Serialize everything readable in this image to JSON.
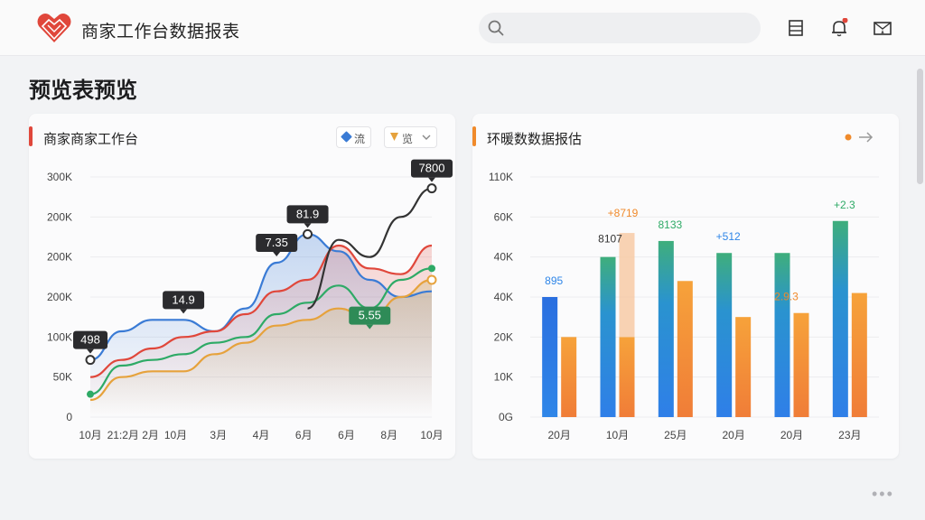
{
  "header": {
    "app_title": "商家工作台数据报表",
    "search_placeholder": "",
    "icons": [
      "logo-icon",
      "search-icon",
      "layout-icon",
      "bell-icon",
      "mail-icon"
    ],
    "colors": {
      "accent_red": "#e0473b",
      "accent_orange": "#f08a2b"
    }
  },
  "page": {
    "title": "预览表预览"
  },
  "left_card": {
    "title": "商家商家工作台",
    "filter_1": "流",
    "filter_2": "览",
    "chart_data": {
      "type": "line",
      "y_tick_labels": [
        "300K",
        "200K",
        "200K",
        "200K",
        "100K",
        "50K",
        "0"
      ],
      "x_tick_labels": [
        "10月",
        "21:2月 2月",
        "10月",
        "3月",
        "4月",
        "6月",
        "6月",
        "8月",
        "10月"
      ],
      "grid": true,
      "series": [
        {
          "color": "#3a7bd5",
          "values": [
            50,
            75,
            85,
            85,
            75,
            95,
            135,
            160,
            145,
            120,
            105,
            110
          ]
        },
        {
          "color": "#e0473b",
          "values": [
            35,
            50,
            60,
            70,
            75,
            90,
            110,
            120,
            150,
            130,
            125,
            150
          ]
        },
        {
          "color": "#2eaa66",
          "values": [
            20,
            45,
            50,
            55,
            65,
            70,
            90,
            100,
            115,
            95,
            120,
            130
          ]
        },
        {
          "color": "#e6a23c",
          "values": [
            15,
            35,
            40,
            40,
            55,
            65,
            80,
            85,
            95,
            85,
            105,
            120
          ]
        },
        {
          "color": "#333333",
          "values": [
            null,
            null,
            null,
            null,
            null,
            null,
            null,
            95,
            155,
            140,
            175,
            200
          ]
        }
      ],
      "annotations": [
        {
          "text": "498",
          "style": "dark"
        },
        {
          "text": "14.9",
          "style": "dark"
        },
        {
          "text": "7.35",
          "style": "dark"
        },
        {
          "text": "81.9",
          "style": "dark"
        },
        {
          "text": "7800",
          "style": "dark"
        },
        {
          "text": "5.55",
          "style": "green"
        }
      ]
    }
  },
  "right_card": {
    "title": "环暖数数据报估",
    "chart_data": {
      "type": "bar",
      "y_tick_labels": [
        "110K",
        "60K",
        "40K",
        "40K",
        "20K",
        "10K",
        "0G"
      ],
      "categories": [
        "20月",
        "10月",
        "25月",
        "20月",
        "20月",
        "23月"
      ],
      "grid": true,
      "series": [
        {
          "color": "#2f86e8",
          "values": [
            30,
            40,
            44,
            41,
            41,
            49
          ]
        },
        {
          "color": "#f39436",
          "values": [
            20,
            20,
            34,
            25,
            26,
            31
          ]
        }
      ],
      "value_labels": [
        "895",
        "+8719",
        "8107",
        "8133",
        "+512",
        "2.9.3",
        "+2.3"
      ]
    }
  }
}
